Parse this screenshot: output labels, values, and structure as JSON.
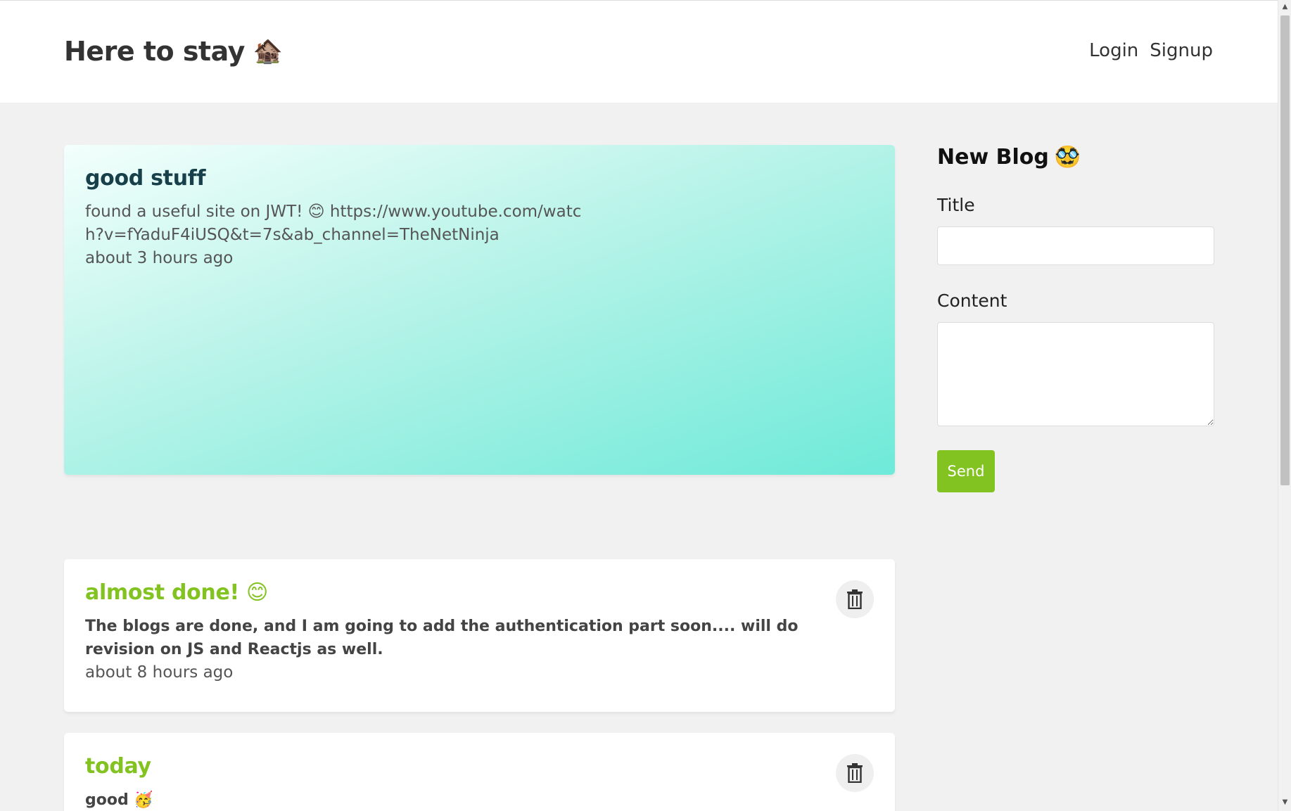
{
  "navbar": {
    "brand": "Here to stay",
    "brand_emoji": "🏚️",
    "links": [
      "Login",
      "Signup"
    ]
  },
  "blogs": [
    {
      "title": "good stuff",
      "body": "found a useful site on JWT! 😊 https://www.youtube.com/watch?v=fYaduF4iUSQ&t=7s&ab_channel=TheNetNinja",
      "time": "about 3 hours ago"
    },
    {
      "title": "almost done! 😊",
      "body": "The blogs are done, and I am going to add the authentication part soon.... will do revision on JS and Reactjs as well.",
      "time": "about 8 hours ago"
    },
    {
      "title": "today",
      "body": "good 🥳",
      "time": ""
    }
  ],
  "sidebar": {
    "title": "New Blog",
    "title_emoji": "🥸",
    "title_label": "Title",
    "content_label": "Content",
    "send_label": "Send"
  },
  "colors": {
    "accent": "#83c321",
    "featured_title": "#17404a",
    "background": "#f1f1f1"
  },
  "icons": {
    "delete": "trash-icon"
  }
}
